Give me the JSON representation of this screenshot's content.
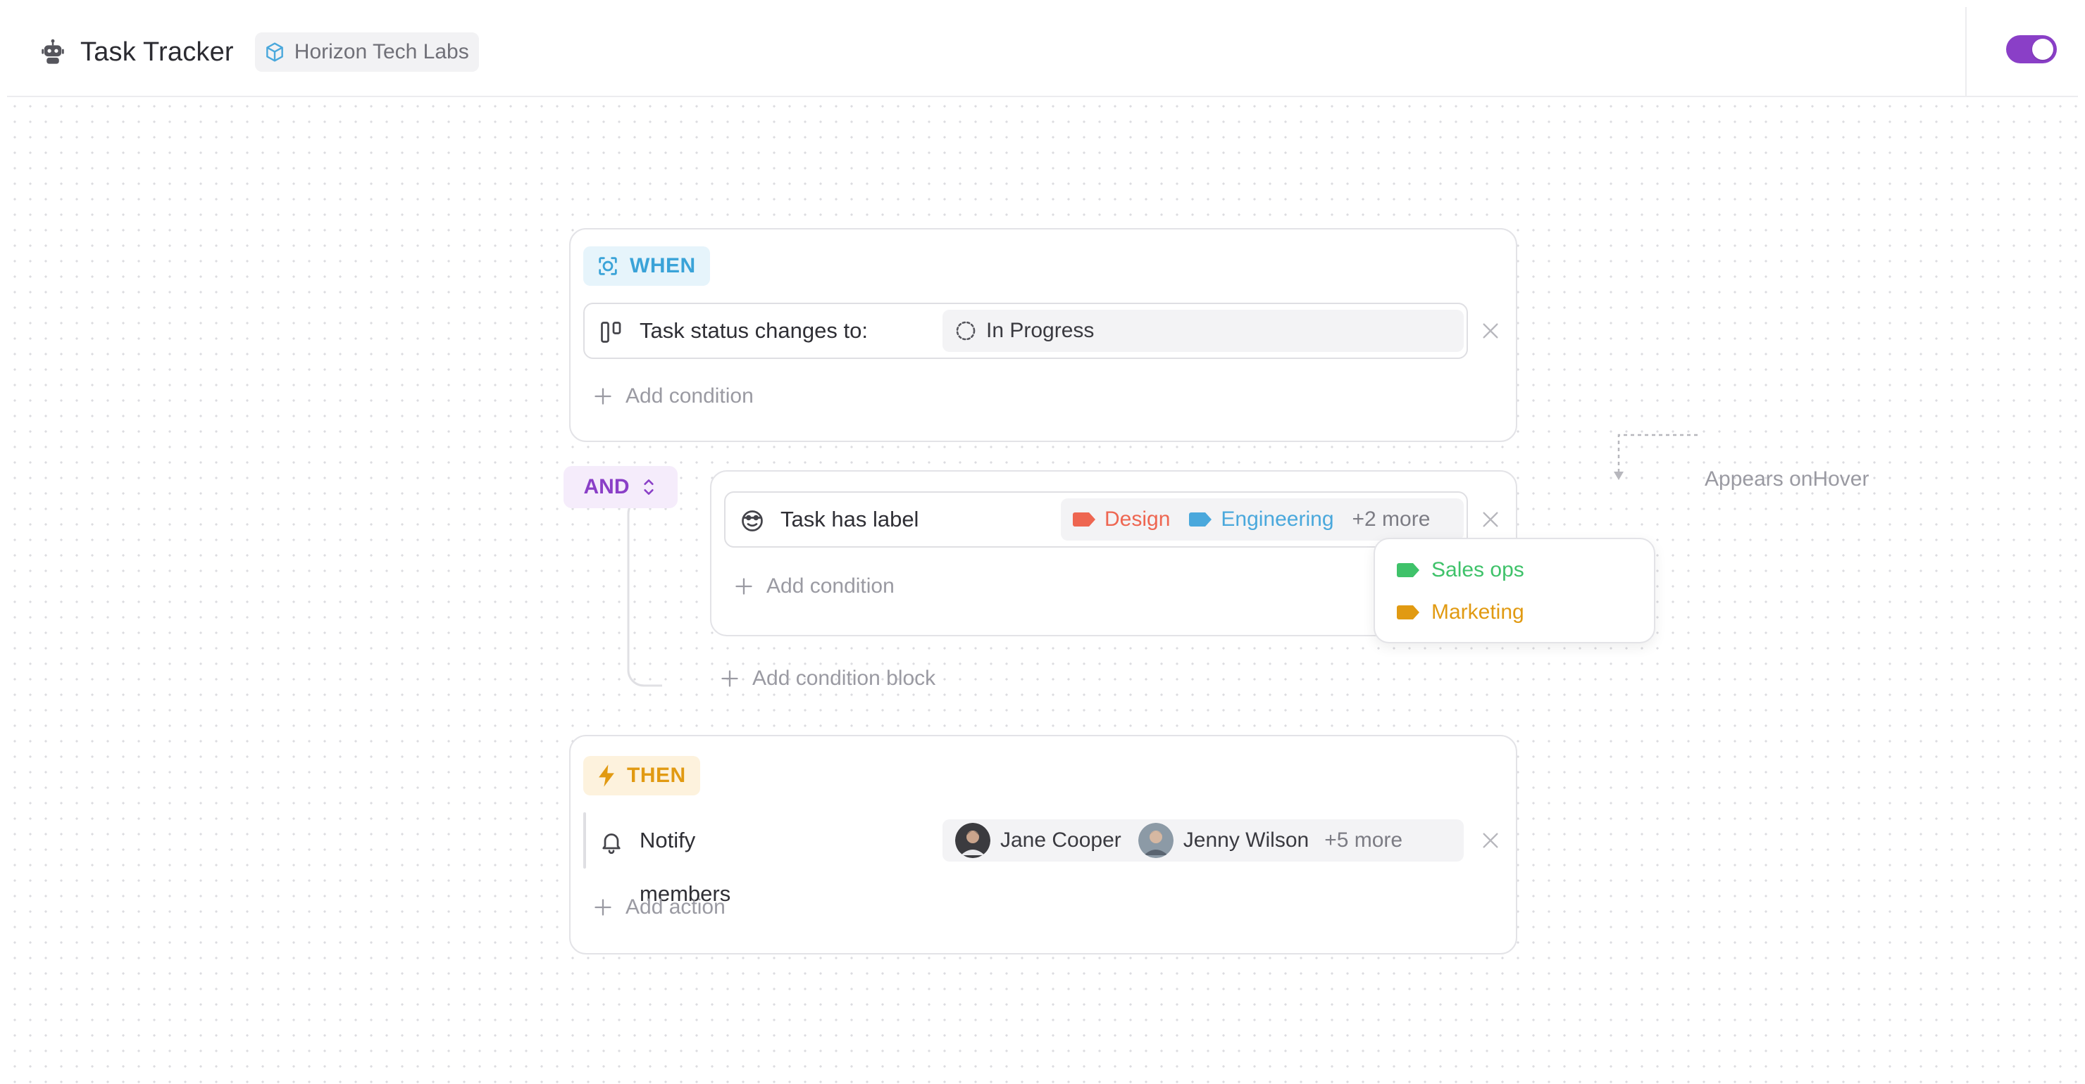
{
  "header": {
    "app_title": "Task Tracker",
    "app_icon": "robot-icon",
    "workspace": {
      "name": "Horizon Tech Labs",
      "icon": "cube-icon",
      "icon_color": "#4aa8dc"
    },
    "toggle": {
      "state": "on",
      "color": "#8a3fc7"
    }
  },
  "when": {
    "tag": "WHEN",
    "tag_color": "#3aa3d8",
    "condition": {
      "icon": "columns-icon",
      "label": "Task status changes to:",
      "value": "In Progress",
      "value_icon": "dashed-progress-icon"
    },
    "add_condition": "Add condition"
  },
  "and_block": {
    "operator": "AND",
    "operator_color": "#8a3fc7",
    "condition": {
      "icon": "tag-smile-icon",
      "label": "Task has label",
      "labels": [
        {
          "name": "Design",
          "color": "#ee6651"
        },
        {
          "name": "Engineering",
          "color": "#4aa8dc"
        }
      ],
      "more": "+2 more"
    },
    "add_condition": "Add condition",
    "add_condition_block": "Add condition block"
  },
  "hover_popup": {
    "note": "Appears onHover",
    "items": [
      {
        "name": "Sales ops",
        "color": "#3fc26a"
      },
      {
        "name": "Marketing",
        "color": "#e19a12"
      }
    ]
  },
  "then": {
    "tag": "THEN",
    "tag_color": "#e19a12",
    "action": {
      "icon": "bell-icon",
      "label": "Notify members",
      "members": [
        {
          "name": "Jane Cooper"
        },
        {
          "name": "Jenny Wilson"
        }
      ],
      "more": "+5 more"
    },
    "add_action": "Add action"
  }
}
